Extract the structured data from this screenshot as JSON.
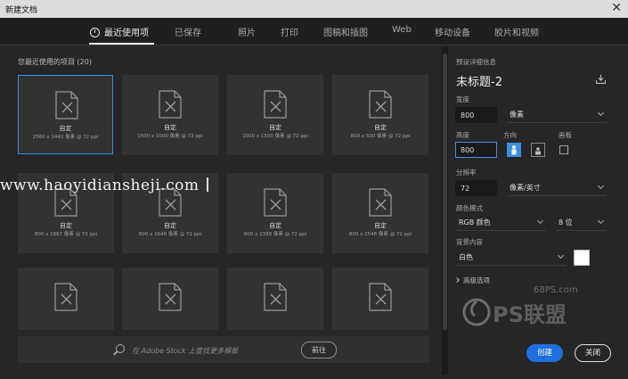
{
  "window": {
    "title": "新建文档"
  },
  "tabs": [
    {
      "label": "最近使用项",
      "active": true
    },
    {
      "label": "已保存"
    },
    {
      "label": "照片"
    },
    {
      "label": "打印"
    },
    {
      "label": "图稿和插图"
    },
    {
      "label": "Web"
    },
    {
      "label": "移动设备"
    },
    {
      "label": "胶片和视频"
    }
  ],
  "recent": {
    "title": "您最近使用的项目",
    "count": "(20)",
    "items": [
      {
        "name": "自定",
        "size": "2560 x 1440 像素 @ 72 ppi"
      },
      {
        "name": "自定",
        "size": "1500 x 1000 像素 @ 72 ppi"
      },
      {
        "name": "自定",
        "size": "1000 x 1500 像素 @ 72 ppi"
      },
      {
        "name": "自定",
        "size": "800 x 500 像素 @ 72 ppi"
      },
      {
        "name": "自定",
        "size": "800 x 1867 像素 @ 72 ppi"
      },
      {
        "name": "自定",
        "size": "800 x 1649 像素 @ 72 ppi"
      },
      {
        "name": "自定",
        "size": "800 x 2388 像素 @ 72 ppi"
      },
      {
        "name": "自定",
        "size": "800 x 2548 像素 @ 72 ppi"
      }
    ]
  },
  "search": {
    "placeholder": "在 Adobe Stock 上查找更多模板",
    "go_label": "前往"
  },
  "watermark": "www.haoyidiansheji.com",
  "preset": {
    "section_label": "预设详细信息",
    "doc_name": "未标题-2",
    "width_label": "宽度",
    "width_value": "800",
    "width_unit": "像素",
    "height_label": "高度",
    "height_value": "800",
    "orientation_label": "方向",
    "artboard_label": "画板",
    "resolution_label": "分辨率",
    "resolution_value": "72",
    "resolution_unit": "像素/英寸",
    "color_mode_label": "颜色模式",
    "color_mode_value": "RGB 颜色",
    "bit_depth": "8 位",
    "background_label": "背景内容",
    "background_value": "白色",
    "advanced_label": "高级选项"
  },
  "logo": {
    "site": "68PS.com",
    "brand": "PS联盟"
  },
  "buttons": {
    "create": "创建",
    "close": "关闭"
  },
  "colors": {
    "accent": "#3b8ee6",
    "create_button": "#1f6fe0",
    "background_swatch": "#ffffff"
  }
}
